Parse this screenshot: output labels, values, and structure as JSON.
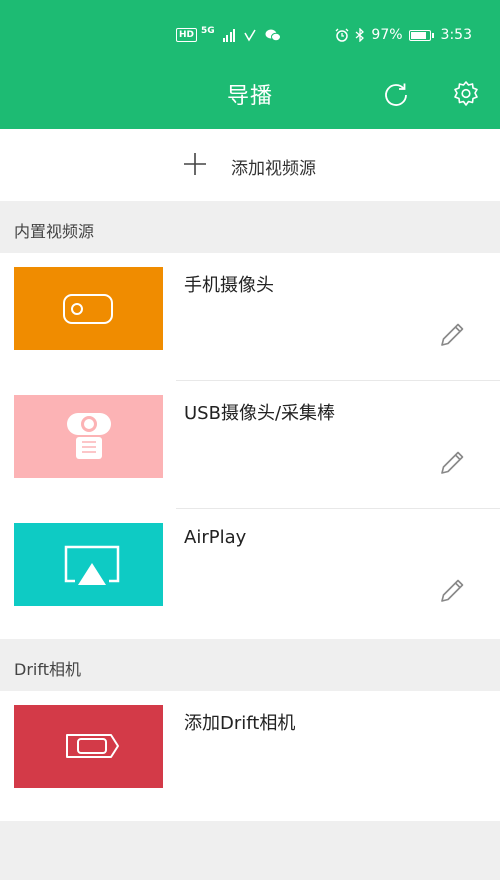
{
  "status_bar": {
    "hd": "HD",
    "network": "5G",
    "battery_percent": "97%",
    "battery_level": 0.97,
    "time": "3:53"
  },
  "header": {
    "title": "导播",
    "color": "#1dbb73"
  },
  "add_source": {
    "label": "添加视频源"
  },
  "builtin_section": {
    "title": "内置视频源",
    "items": [
      {
        "name": "手机摄像头",
        "color": "#f08c00",
        "icon": "phone-camera-icon"
      },
      {
        "name": "USB摄像头/采集棒",
        "color": "#fcb3b5",
        "icon": "webcam-icon"
      },
      {
        "name": "AirPlay",
        "color": "#0ecbc4",
        "icon": "airplay-icon"
      }
    ]
  },
  "drift_section": {
    "title": "Drift相机",
    "items": [
      {
        "name": "添加Drift相机",
        "color": "#d33a48",
        "icon": "action-camera-icon"
      }
    ]
  }
}
